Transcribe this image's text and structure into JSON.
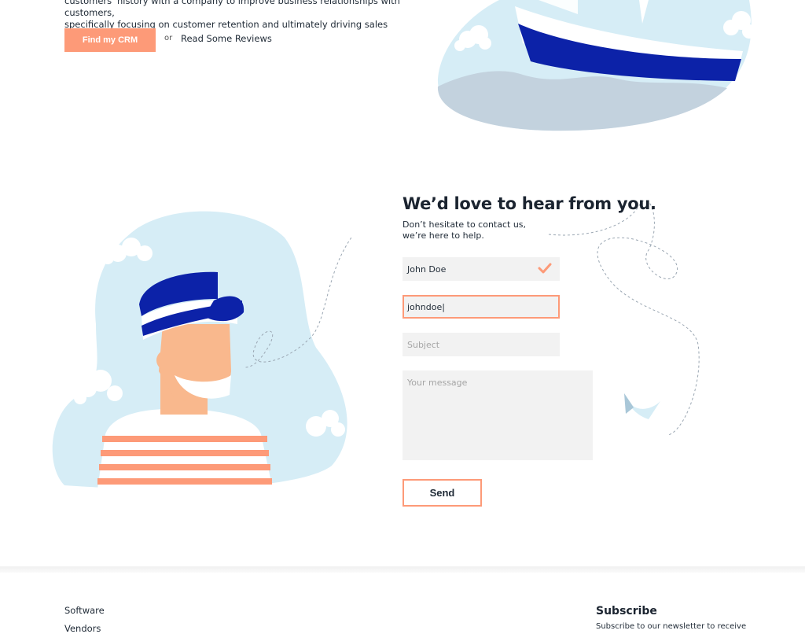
{
  "hero": {
    "text_line1": "customers' history with a company to improve business relationships with customers,",
    "text_line2": "specifically focusing on customer retention and ultimately driving sales growth.",
    "cta_label": "Find my CRM",
    "or_label": "or",
    "reviews_label": "Read Some Reviews"
  },
  "contact": {
    "title": "We’d love to hear from you.",
    "subtitle_line1": "Don’t hesitate to contact us,",
    "subtitle_line2": "we’re here to help.",
    "name_value": "John Doe",
    "email_value": "johndoe|",
    "subject_placeholder": "Subject",
    "message_placeholder": "Your message",
    "send_label": "Send"
  },
  "footer": {
    "links": [
      "Software",
      "Vendors"
    ],
    "subscribe_title": "Subscribe",
    "subscribe_text": "Subscribe to our newsletter to receive"
  },
  "colors": {
    "accent": "#fd9a78",
    "navy": "#0c22a8",
    "light_blue": "#d6edf6",
    "field_bg": "#f2f2f2"
  },
  "icons": [
    "checkmark-icon"
  ]
}
